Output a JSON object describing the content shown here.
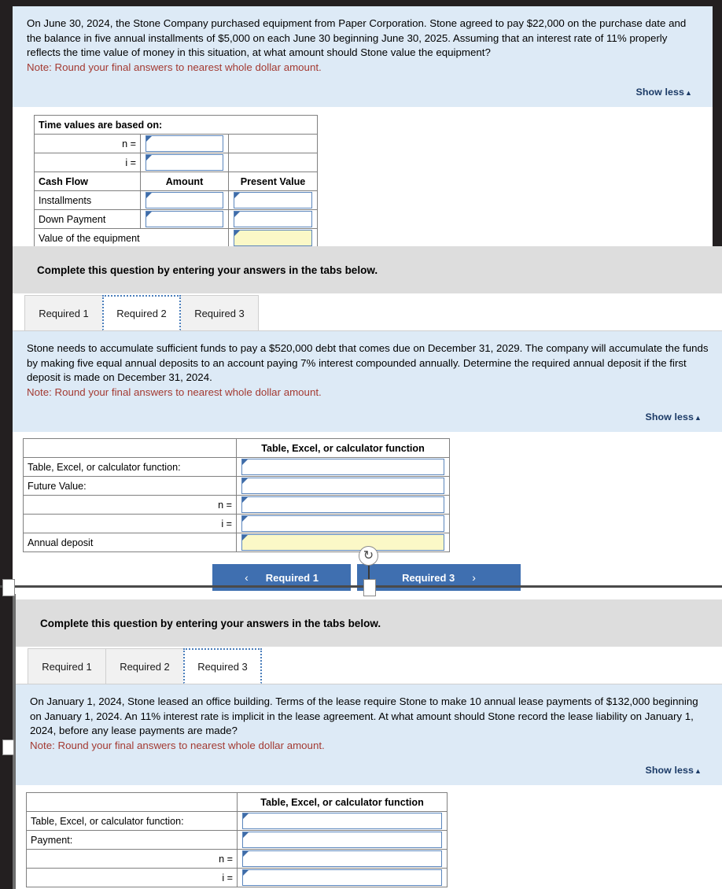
{
  "panel_one": {
    "question": "On June 30, 2024, the Stone Company purchased equipment from Paper Corporation. Stone agreed to pay $22,000 on the purchase date and the balance in five annual installments of $5,000 on each June 30 beginning June 30, 2025. Assuming that an interest rate of 11% properly reflects the time value of money in this situation, at what amount should Stone value the equipment?",
    "note": "Note: Round your final answers to nearest whole dollar amount.",
    "show_less": "Show less",
    "show_less_caret": "▲",
    "table": {
      "title_row": "Time values are based on:",
      "n_label": "n =",
      "i_label": "i =",
      "col_cash_flow": "Cash Flow",
      "col_amount": "Amount",
      "col_present_value": "Present Value",
      "row_installments": "Installments",
      "row_down_payment": "Down Payment",
      "row_value_equipment": "Value of the equipment",
      "n_value": "",
      "i_value": "",
      "installments_amount": "",
      "installments_pv": "",
      "down_payment_amount": "",
      "down_payment_pv": "",
      "value_equipment_pv": ""
    }
  },
  "panel_two": {
    "instruction": "Complete this question by entering your answers in the tabs below.",
    "tabs": [
      {
        "label": "Required 1",
        "active": false
      },
      {
        "label": "Required 2",
        "active": true
      },
      {
        "label": "Required 3",
        "active": false
      }
    ],
    "question": "Stone needs to accumulate sufficient funds to pay a $520,000 debt that comes due on December 31, 2029. The company will accumulate the funds by making five equal annual deposits to an account paying 7% interest compounded annually. Determine the required annual deposit if the first deposit is made on December 31, 2024.",
    "note": "Note: Round your final answers to nearest whole dollar amount.",
    "show_less": "Show less",
    "show_less_caret": "▲",
    "table": {
      "col_blank": "",
      "col_function": "Table, Excel, or calculator function",
      "row_function": "Table, Excel, or calculator function:",
      "row_future_value": "Future Value:",
      "row_n": "n =",
      "row_i": "i =",
      "row_annual_deposit": "Annual deposit",
      "function_value": "",
      "future_value": "",
      "n_value": "",
      "i_value": "",
      "annual_deposit_value": ""
    },
    "nav": {
      "prev_label": "Required 1",
      "prev_chevron": "‹",
      "next_label": "Required 3",
      "next_chevron": "›"
    },
    "refresh_icon": "↻"
  },
  "panel_three": {
    "instruction": "Complete this question by entering your answers in the tabs below.",
    "tabs": [
      {
        "label": "Required 1",
        "active": false
      },
      {
        "label": "Required 2",
        "active": false
      },
      {
        "label": "Required 3",
        "active": true
      }
    ],
    "question": "On January 1, 2024, Stone leased an office building. Terms of the lease require Stone to make 10 annual lease payments of $132,000 beginning on January 1, 2024. An 11% interest rate is implicit in the lease agreement. At what amount should Stone record the lease liability on January 1, 2024, before any lease payments are made?",
    "note": "Note: Round your final answers to nearest whole dollar amount.",
    "show_less": "Show less",
    "show_less_caret": "▲",
    "table": {
      "col_blank": "",
      "col_function": "Table, Excel, or calculator function",
      "row_function": "Table, Excel, or calculator function:",
      "row_payment": "Payment:",
      "row_n": "n =",
      "row_i": "i =",
      "function_value": "",
      "payment_value": "",
      "n_value": "",
      "i_value": ""
    }
  },
  "colors": {
    "table_header_blue": "#8db3e2",
    "question_bg": "#ddeaf6",
    "note_red": "#a33a32",
    "answer_yellow": "#fbf8c7",
    "nav_button_blue": "#3f6fb0",
    "band_gray": "#dddddd"
  }
}
